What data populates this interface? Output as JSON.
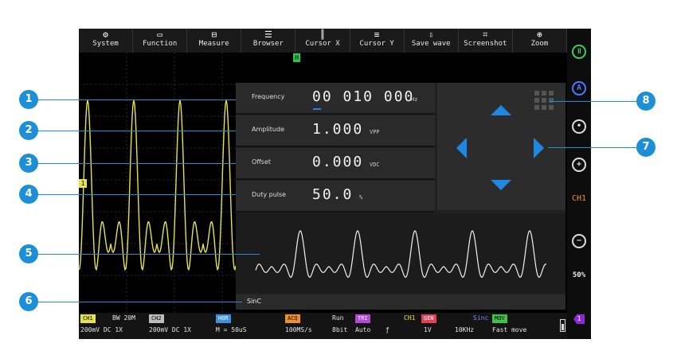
{
  "menu": [
    {
      "label": "System",
      "icon": "gear-icon",
      "glyph": "⚙"
    },
    {
      "label": "Function",
      "icon": "monitor-icon",
      "glyph": "▭"
    },
    {
      "label": "Measure",
      "icon": "ruler-icon",
      "glyph": "⊟"
    },
    {
      "label": "Browser",
      "icon": "database-icon",
      "glyph": "☰"
    },
    {
      "label": "Cursor X",
      "icon": "cursor-x-icon",
      "glyph": "║"
    },
    {
      "label": "Cursor Y",
      "icon": "cursor-y-icon",
      "glyph": "≡"
    },
    {
      "label": "Save wave",
      "icon": "save-wave-icon",
      "glyph": "⇩"
    },
    {
      "label": "Screenshot",
      "icon": "crop-icon",
      "glyph": "⌗"
    },
    {
      "label": "Zoom",
      "icon": "zoom-icon",
      "glyph": "⊕"
    }
  ],
  "params": {
    "frequency": {
      "label": "Frequency",
      "value": "00 010 000",
      "unit": "Hz"
    },
    "amplitude": {
      "label": "Amplitude",
      "value": "1.000",
      "unit": "VPP"
    },
    "offset": {
      "label": "Offset",
      "value": "0.000",
      "unit": "VDC"
    },
    "duty": {
      "label": "Duty pulse",
      "value": "50.0",
      "unit": "%"
    }
  },
  "waveform_name": "SinC",
  "sidebar": {
    "ch_label": "CH1",
    "percent": "50%"
  },
  "markers": {
    "trigger": "H",
    "channel": "1"
  },
  "status": {
    "ch1_tag": "CH1",
    "bw": "BW 20M",
    "ch2_tag": "CH2",
    "ch1_vals": "200mV  DC   1X",
    "ch2_vals": "200mV  DC   1X",
    "hor_tag": "HOR",
    "hor_val": "M = 50uS",
    "acq_tag": "ACQ",
    "acq_val": "100MS/s",
    "run": "Run",
    "bits": "8bit",
    "tri_tag": "TRI",
    "tri_val": "Auto",
    "tri_ch": "CH1",
    "gen_tag": "GEN",
    "gen_val": "1V",
    "sinc": "Sinc",
    "gen_freq": "10KHz",
    "mov_tag": "MOV",
    "mov_val": "Fast move"
  },
  "callouts": [
    "1",
    "2",
    "3",
    "4",
    "5",
    "6",
    "7",
    "8"
  ],
  "colors": {
    "accent": "#1d8fd6",
    "ch1": "#e6e34a",
    "arrow": "#1e88e5"
  }
}
